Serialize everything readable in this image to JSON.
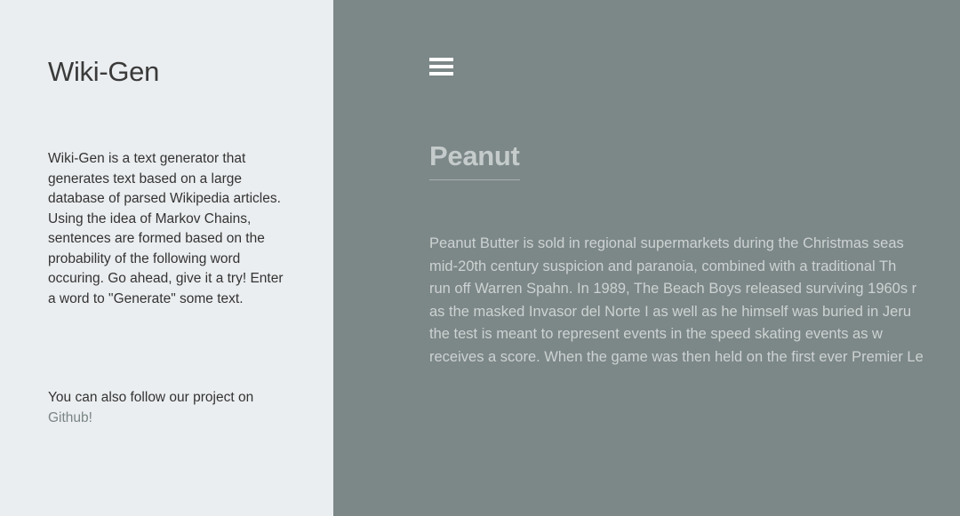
{
  "sidebar": {
    "title": "Wiki-Gen",
    "intro": "Wiki-Gen is a text generator that generates text based on a large database of parsed Wikipedia articles. Using the idea of Markov Chains, sentences are formed based on the probability of the following word occuring. Go ahead, give it a try! Enter a word to \"Generate\" some text.",
    "follow_text": "You can also follow our project on",
    "github_link": "Github!"
  },
  "main": {
    "menu_icon": "hamburger-menu-icon",
    "article_title": "Peanut",
    "article_lines": [
      "Peanut Butter is sold in regional supermarkets during the Christmas seas",
      "mid-20th century suspicion and paranoia, combined with a traditional Th",
      "run off Warren Spahn. In 1989, The Beach Boys released surviving 1960s r",
      "as the masked Invasor del Norte I as well as he himself was buried in Jeru",
      "the test is meant to represent events in the speed skating events as w",
      "receives a score. When the game was then held on the first ever Premier Le"
    ]
  },
  "colors": {
    "sidebar_bg": "#ebeef0",
    "main_bg": "#7c8787",
    "link": "#7a8584"
  }
}
